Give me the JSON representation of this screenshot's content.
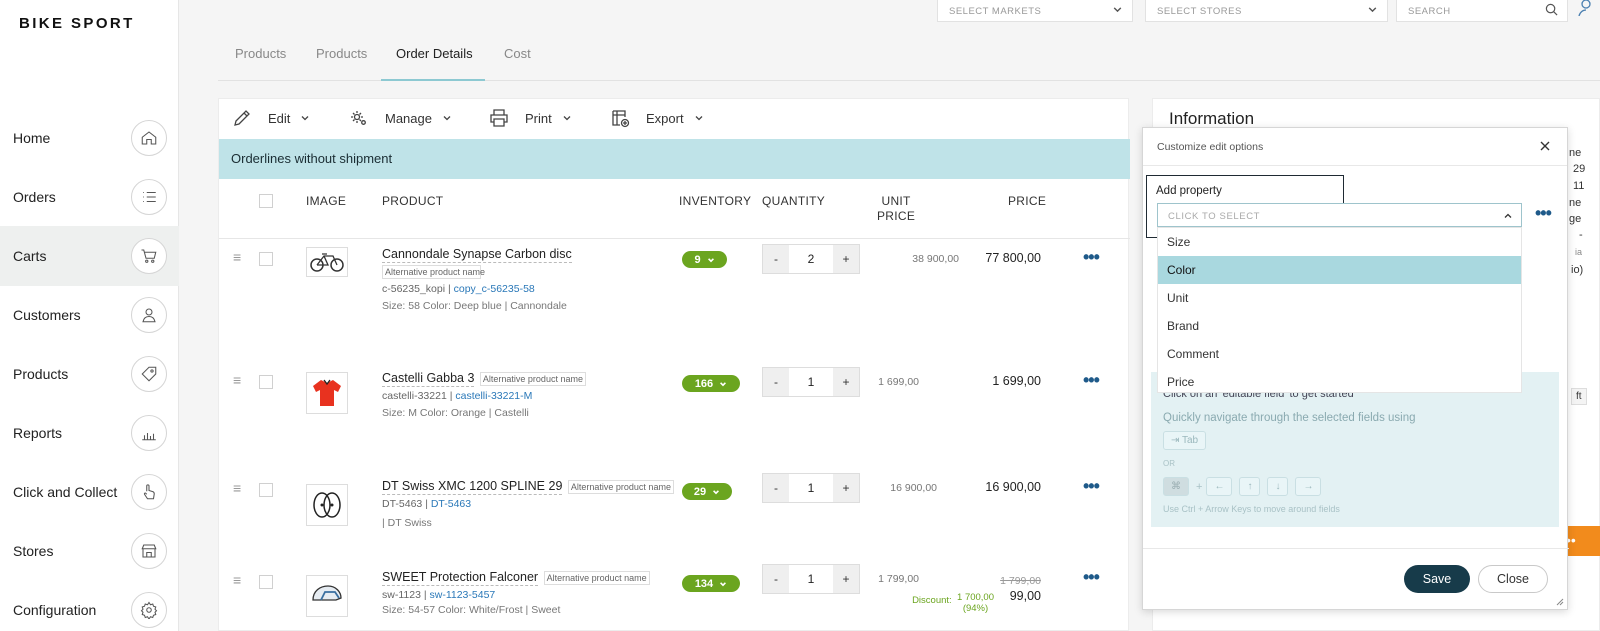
{
  "app": {
    "logo": "BIKE SPORT"
  },
  "sidebar": {
    "items": [
      {
        "label": "Home",
        "icon": "home-icon"
      },
      {
        "label": "Orders",
        "icon": "list-icon"
      },
      {
        "label": "Carts",
        "icon": "cart-icon"
      },
      {
        "label": "Customers",
        "icon": "user-icon"
      },
      {
        "label": "Products",
        "icon": "tag-icon"
      },
      {
        "label": "Reports",
        "icon": "bar-chart-icon"
      },
      {
        "label": "Click and Collect",
        "icon": "hand-pointer-icon"
      },
      {
        "label": "Stores",
        "icon": "store-icon"
      },
      {
        "label": "Configuration",
        "icon": "gear-icon"
      }
    ]
  },
  "topbar": {
    "markets_placeholder": "SELECT MARKETS",
    "stores_placeholder": "SELECT STORES",
    "search_placeholder": "SEARCH"
  },
  "tabs": [
    {
      "label": "Products"
    },
    {
      "label": "Products"
    },
    {
      "label": "Order Details"
    },
    {
      "label": "Cost"
    }
  ],
  "toolbar": {
    "edit": "Edit",
    "manage": "Manage",
    "print": "Print",
    "export": "Export"
  },
  "banner": "Orderlines without shipment",
  "table": {
    "headers": {
      "image": "IMAGE",
      "product": "PRODUCT",
      "inventory": "INVENTORY",
      "quantity": "QUANTITY",
      "unit_price_1": "UNIT",
      "unit_price_2": "PRICE",
      "price": "PRICE"
    },
    "rows": [
      {
        "name": "Cannondale Synapse Carbon disc",
        "alt_name": "Alternative product name",
        "sku": "c-56235_kopi",
        "sku_link": "copy_c-56235-58",
        "attrs": "Size: 58   Color: Deep blue   |   Cannondale",
        "inventory": "9",
        "quantity": "2",
        "unit_price": "38 900,00",
        "price": "77 800,00"
      },
      {
        "name": "Castelli Gabba 3",
        "alt_name": "Alternative product name",
        "sku": "castelli-33221",
        "sku_link": "castelli-33221-M",
        "attrs": "Size: M   Color: Orange   |   Castelli",
        "inventory": "166",
        "quantity": "1",
        "unit_price": "1 699,00",
        "price": "1 699,00"
      },
      {
        "name": "DT Swiss XMC 1200 SPLINE 29",
        "alt_name": "Alternative product name",
        "sku": "DT-5463",
        "sku_link": "DT-5463",
        "attrs": "|  DT Swiss",
        "inventory": "29",
        "quantity": "1",
        "unit_price": "16 900,00",
        "price": "16 900,00"
      },
      {
        "name": "SWEET Protection Falconer",
        "alt_name": "Alternative product name",
        "sku": "sw-1123",
        "sku_link": "sw-1123-5457",
        "attrs": "Size: 54-57   Color: White/Frost   |   Sweet",
        "inventory": "134",
        "quantity": "1",
        "unit_price": "1 799,00",
        "discount_label": "Discount:",
        "discount_value": "1 700,00",
        "discount_pct": "(94%)",
        "price_original": "1 799,00",
        "price": "99,00"
      }
    ]
  },
  "info_panel": {
    "title": "Information",
    "side_texts": [
      "ne",
      "29",
      "11",
      "ne",
      "ge",
      "-",
      "ia",
      "io)",
      "ft"
    ]
  },
  "modal": {
    "title": "Customize edit options",
    "add_property_label": "Add property",
    "select_placeholder": "CLICK TO SELECT",
    "options": [
      "Size",
      "Color",
      "Unit",
      "Brand",
      "Comment",
      "Price"
    ],
    "selected_option": "Color",
    "help_line1": "Click on an 'editable field' to get started",
    "help_line2": "Quickly navigate through the selected fields using",
    "tab_key": "⇥ Tab",
    "or_text": "OR",
    "cmd_key": "⌘",
    "plus": "+",
    "arrow_keys": [
      "←",
      "↑",
      "↓",
      "→"
    ],
    "help_hint": "Use Ctrl + Arrow Keys to move around fields",
    "save": "Save",
    "close": "Close"
  },
  "colors": {
    "banner": "#bfe3e8",
    "inventory_badge": "#6ba51f",
    "save_button": "#173b4a",
    "link": "#2a78b8",
    "selected_option": "#a9d8df"
  }
}
